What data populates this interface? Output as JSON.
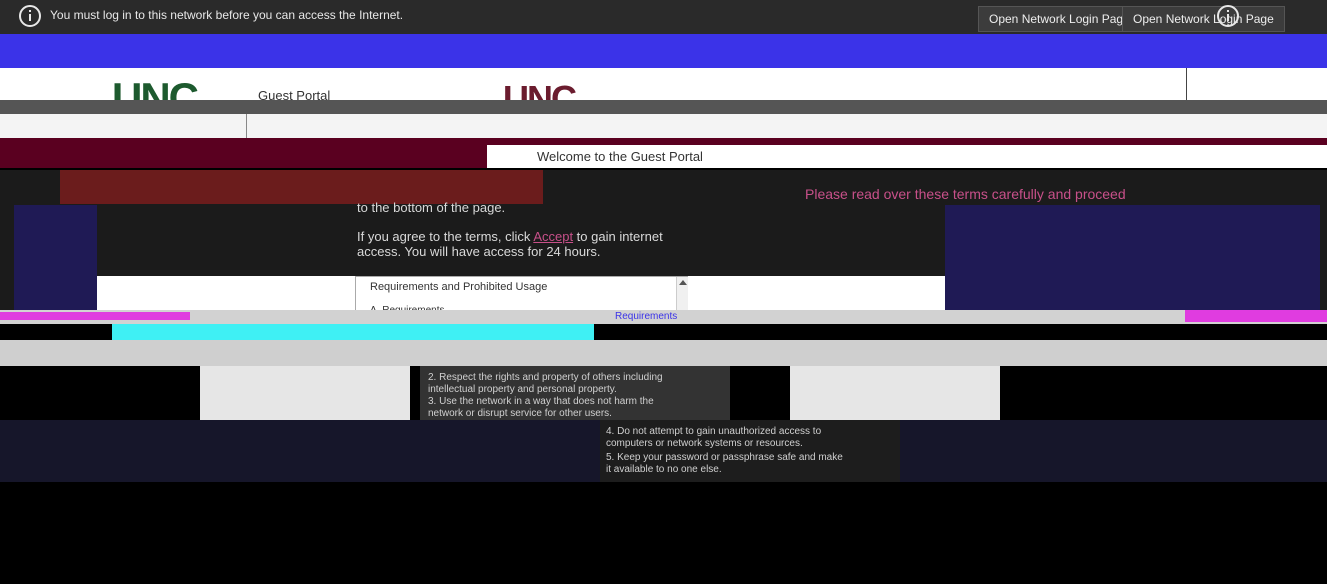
{
  "banner": {
    "message": "You must log in to this network before you can access the Internet.",
    "open_login_button": "Open Network Login Page",
    "open_login_button_2": "Open Network Login Page"
  },
  "header": {
    "logo_text": "UNC",
    "portal_title": "Guest Portal",
    "welcome": "Welcome to the Guest Portal"
  },
  "main": {
    "read_carefully": "Please read over these terms carefully and proceed",
    "intro_line1": "to the bottom of the page.",
    "intro_line2_prefix": "If you agree to the terms, click ",
    "intro_accept": "Accept",
    "intro_line2_suffix": " to gain internet",
    "intro_line3": "access. You will have access for 24 hours.",
    "terms_heading": "Requirements and Prohibited Usage",
    "terms_subheading": "A. Requirements",
    "requirements_label": "Requirements",
    "terms_items": [
      "2. Respect the rights and property of others including",
      "intellectual property and personal property.",
      "3. Use the network in a way that does not harm the",
      "network or disrupt service for other users.",
      "4. Do not attempt to gain unauthorized access to",
      "computers or network systems or resources.",
      "5. Keep your password or passphrase safe and make",
      "it available to no one else."
    ]
  },
  "colors": {
    "banner_bg": "#2a2a2a",
    "brand_green": "#1d5a2e",
    "brand_maroon": "#5a0020",
    "link_pink": "#c8508a",
    "glitch_blue": "#3b33e8"
  }
}
